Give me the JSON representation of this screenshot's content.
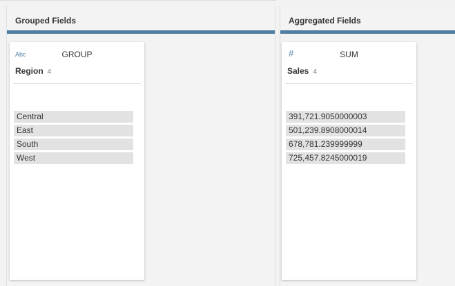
{
  "grouped": {
    "header": "Grouped Fields",
    "card": {
      "type_icon": "Abc",
      "aggregation": "GROUP",
      "field_name": "Region",
      "count": "4",
      "values": [
        "Central",
        "East",
        "South",
        "West"
      ]
    }
  },
  "aggregated": {
    "header": "Aggregated Fields",
    "card": {
      "type_icon": "#",
      "aggregation": "SUM",
      "field_name": "Sales",
      "count": "4",
      "values": [
        "391,721.9050000003",
        "501,239.8908000014",
        "678,781.239999999",
        "725,457.8245000019"
      ]
    }
  },
  "colors": {
    "accent_bar": "#4e7ea0",
    "type_icon": "#4b7ea5",
    "value_row_bg": "#e2e2e2"
  }
}
